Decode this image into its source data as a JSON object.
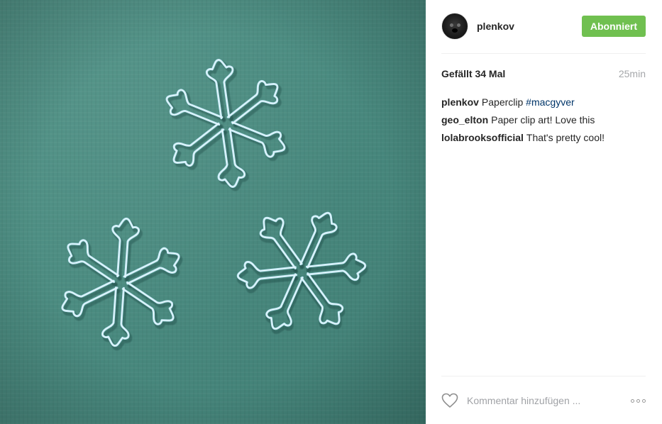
{
  "post": {
    "username": "plenkov",
    "follow_label": "Abonniert",
    "likes_text": "Gefällt 34 Mal",
    "time_text": "25min",
    "caption": {
      "author": "plenkov",
      "text": "Paperclip",
      "hashtag": "#macgyver"
    },
    "comments": [
      {
        "author": "geo_elton",
        "text": "Paper clip art! Love this"
      },
      {
        "author": "lolabrooksofficial",
        "text": "That's pretty cool!"
      }
    ],
    "comment_placeholder": "Kommentar hinzufügen ...",
    "image_alt": "Three paperclip snowflakes on a green fabric background"
  },
  "colors": {
    "follow_button": "#70c050",
    "hashtag": "#003569",
    "background_fabric": "#4a8b80",
    "paperclip": "#c8f0ff"
  },
  "icons": {
    "heart": "heart-icon",
    "more": "more-options-icon",
    "avatar": "avatar"
  }
}
